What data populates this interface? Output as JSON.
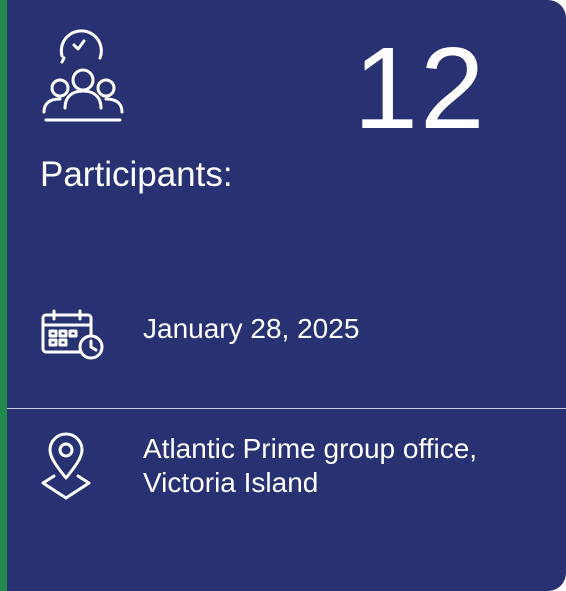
{
  "participants": {
    "count": "12",
    "label": "Participants:",
    "icon": "users-clock-icon"
  },
  "event": {
    "date": "January 28, 2025",
    "date_icon": "calendar-clock-icon",
    "location_line1": "Atlantic Prime group office,",
    "location_line2": "Victoria Island",
    "location_icon": "map-pin-icon"
  },
  "colors": {
    "background": "#283171",
    "accent": "#1f8a4c",
    "text": "#ffffff"
  }
}
